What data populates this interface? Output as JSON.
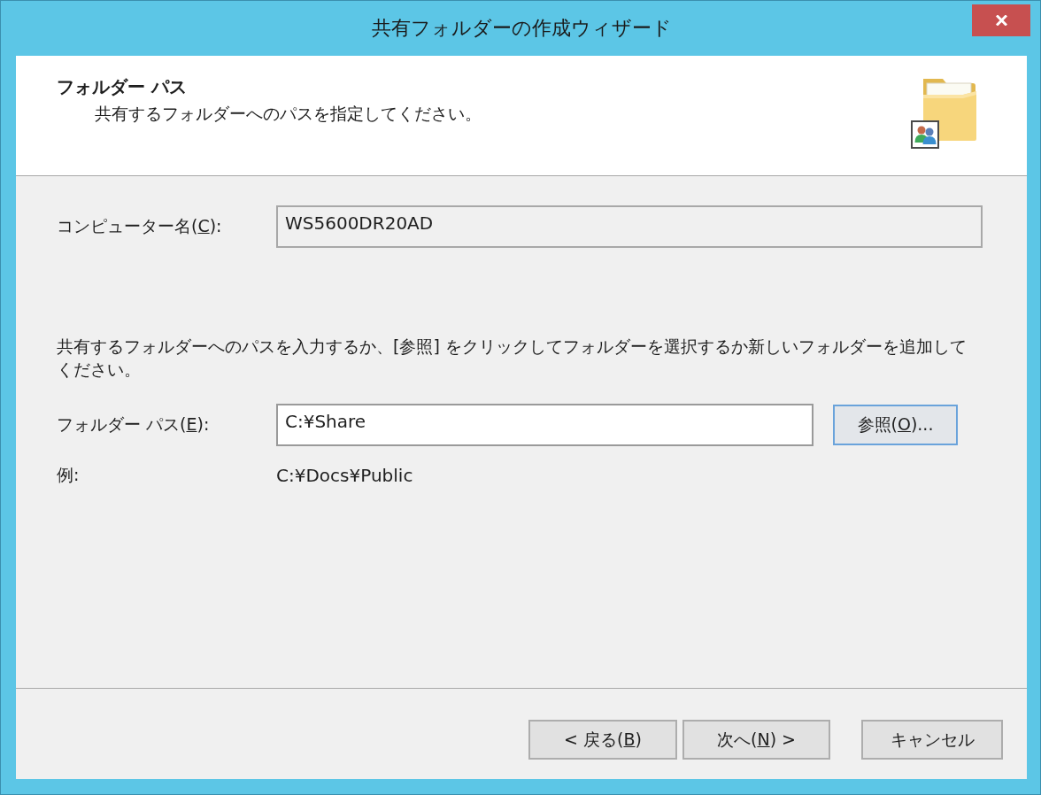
{
  "window": {
    "title": "共有フォルダーの作成ウィザード"
  },
  "header": {
    "title": "フォルダー パス",
    "subtitle": "共有するフォルダーへのパスを指定してください。"
  },
  "computer_name": {
    "label": {
      "before": "コンピューター名(",
      "key": "C",
      "after": "):"
    },
    "value": "WS5600DR20AD",
    "read_only": true
  },
  "instruction": "共有するフォルダーへのパスを入力するか、[参照] をクリックしてフォルダーを選択するか新しいフォルダーを追加してください。",
  "folder_path": {
    "label": {
      "before": "フォルダー パス(",
      "key": "E",
      "after": "):"
    },
    "value": "C:¥Share",
    "read_only": false
  },
  "browse_button": {
    "label": {
      "before": "参照(",
      "key": "O",
      "after": ")..."
    },
    "focused": true
  },
  "example": {
    "label": "例:",
    "value": "C:¥Docs¥Public"
  },
  "buttons": [
    {
      "label": {
        "before": "< 戻る(",
        "key": "B",
        "after": ") "
      },
      "focused": false,
      "kind": "back"
    },
    {
      "label": {
        "before": "次へ(",
        "key": "N",
        "after": ") >"
      },
      "focused": false,
      "kind": "next"
    },
    {
      "label": {
        "before": "キャンセル"
      },
      "focused": false,
      "kind": "cancel"
    }
  ]
}
